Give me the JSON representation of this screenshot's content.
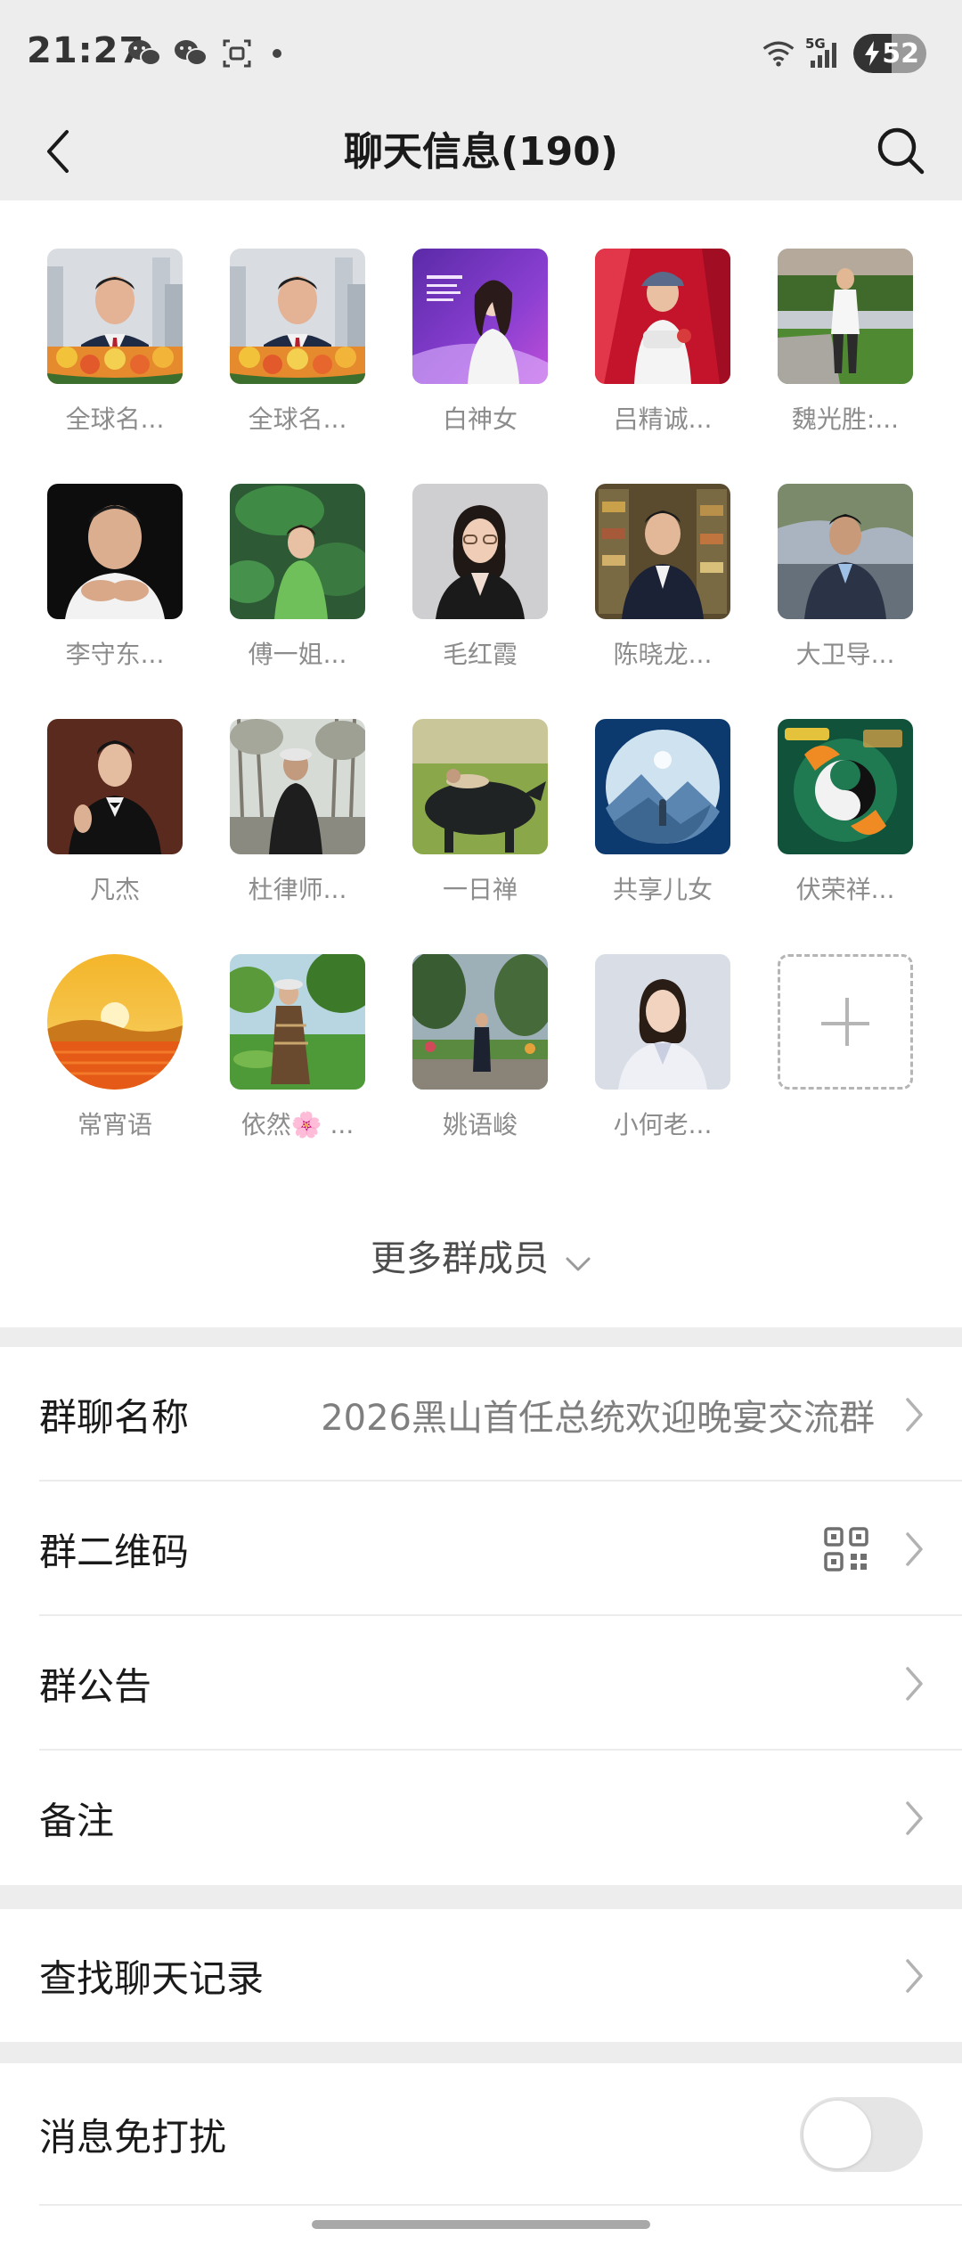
{
  "status_bar": {
    "time": "21:27",
    "network": "5G",
    "battery": "52",
    "battery_level": 0.52
  },
  "header": {
    "title": "聊天信息(190)"
  },
  "members": [
    {
      "name": "全球名...",
      "avatar": "man-suit-flowers-city"
    },
    {
      "name": "全球名...",
      "avatar": "man-suit-flowers-city"
    },
    {
      "name": "白神女",
      "avatar": "woman-purple-poster"
    },
    {
      "name": "吕精诚...",
      "avatar": "man-stage-red"
    },
    {
      "name": "魏光胜:...",
      "avatar": "man-garden-white-shirt"
    },
    {
      "name": "李守东...",
      "avatar": "man-black-portrait"
    },
    {
      "name": "傅一姐...",
      "avatar": "woman-lotus-green"
    },
    {
      "name": "毛红霞",
      "avatar": "woman-glasses-blazer"
    },
    {
      "name": "陈晓龙...",
      "avatar": "man-bookshelf"
    },
    {
      "name": "大卫导...",
      "avatar": "man-outdoor-suit"
    },
    {
      "name": "凡杰",
      "avatar": "man-tuxedo-brown"
    },
    {
      "name": "杜律师...",
      "avatar": "man-hat-trees"
    },
    {
      "name": "一日禅",
      "avatar": "person-buffalo-field"
    },
    {
      "name": "共享儿女",
      "avatar": "circle-mountains-blue"
    },
    {
      "name": "伏荣祥...",
      "avatar": "koi-yinyang-green"
    },
    {
      "name": "常宵语",
      "avatar": "sunset-round"
    },
    {
      "name": "依然🌸 ...",
      "avatar": "woman-garden-hat"
    },
    {
      "name": "姚语峻",
      "avatar": "man-park-trees"
    },
    {
      "name": "小何老...",
      "avatar": "woman-white-blazer"
    }
  ],
  "add_member_icon": "plus-icon",
  "more_members_label": "更多群成员",
  "settings": {
    "group_name_label": "群聊名称",
    "group_name_value": "2026黑山首任总统欢迎晚宴交流群",
    "qr_label": "群二维码",
    "announcement_label": "群公告",
    "remark_label": "备注",
    "search_history_label": "查找聊天记录",
    "mute_label": "消息免打扰",
    "mute_on": false
  }
}
